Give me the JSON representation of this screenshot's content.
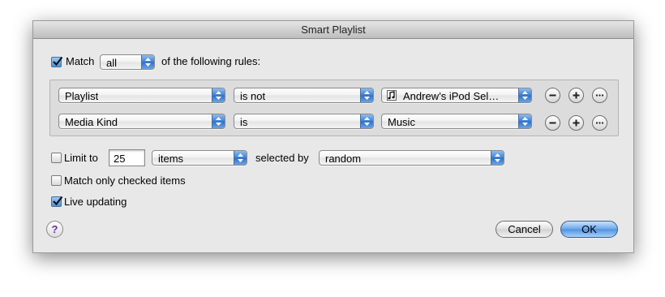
{
  "window": {
    "title": "Smart Playlist"
  },
  "match": {
    "label": "Match",
    "mode": "all",
    "suffix": "of the following rules:",
    "checked": true
  },
  "rules": [
    {
      "field": "Playlist",
      "operator": "is not",
      "value": "Andrew’s iPod Sel…",
      "value_icon": "music-note-icon"
    },
    {
      "field": "Media Kind",
      "operator": "is",
      "value": "Music"
    }
  ],
  "rule_buttons": {
    "remove": "−",
    "add": "+",
    "more": "···"
  },
  "limit": {
    "label": "Limit to",
    "value": "25",
    "unit": "items",
    "selected_by_label": "selected by",
    "selected_by": "random",
    "checked": false
  },
  "options": {
    "match_checked": {
      "label": "Match only checked items",
      "checked": false
    },
    "live_updating": {
      "label": "Live updating",
      "checked": true
    }
  },
  "help": {
    "label": "?"
  },
  "buttons": {
    "cancel": "Cancel",
    "ok": "OK"
  }
}
